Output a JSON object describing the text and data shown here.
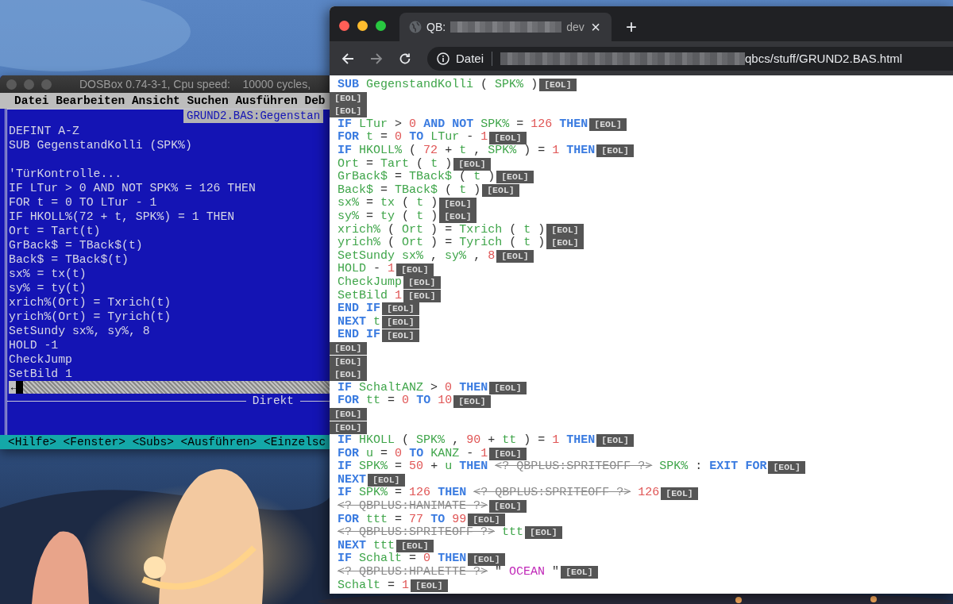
{
  "dosbox": {
    "title": "DOSBox 0.74-3-1, Cpu speed:    10000 cycles,",
    "menu": [
      "Datei",
      "Bearbeiten",
      "Ansicht",
      "Suchen",
      "Ausführen",
      "Deb"
    ],
    "file_tab": "GRUND2.BAS:Gegenstan",
    "code_lines": [
      {
        "kind": "code",
        "text": "DEFINT A-Z"
      },
      {
        "kind": "code",
        "text": "SUB GegenstandKolli (SPK%)"
      },
      {
        "kind": "blank"
      },
      {
        "kind": "code",
        "text": "'TürKontrolle..."
      },
      {
        "kind": "code",
        "text": "IF LTur > 0 AND NOT SPK% = 126 THEN"
      },
      {
        "kind": "code",
        "text": "FOR t = 0 TO LTur - 1"
      },
      {
        "kind": "code",
        "text": "IF HKOLL%(72 + t, SPK%) = 1 THEN"
      },
      {
        "kind": "code",
        "text": "Ort = Tart(t)"
      },
      {
        "kind": "code",
        "text": "GrBack$ = TBack$(t)"
      },
      {
        "kind": "code",
        "text": "Back$ = TBack$(t)"
      },
      {
        "kind": "code",
        "text": "sx% = tx(t)"
      },
      {
        "kind": "code",
        "text": "sy% = ty(t)"
      },
      {
        "kind": "code",
        "text": "xrich%(Ort) = Txrich(t)"
      },
      {
        "kind": "code",
        "text": "yrich%(Ort) = Tyrich(t)"
      },
      {
        "kind": "code",
        "text": "SetSundy sx%, sy%, 8"
      },
      {
        "kind": "code",
        "text": "HOLD -1"
      },
      {
        "kind": "code",
        "text": "CheckJump"
      },
      {
        "kind": "code",
        "text": "SetBild 1"
      }
    ],
    "scroll_arrow": "←",
    "immediate_title": "Direkt",
    "shortcuts": [
      "<Hilfe>",
      "<Fenster>",
      "<Subs>",
      "<Ausführen>",
      "<Einzelsc"
    ]
  },
  "browser": {
    "tab": {
      "title_start": "QB:",
      "title_end": "dev",
      "close": "×"
    },
    "new_tab": "+",
    "back": {
      "disabled": false
    },
    "forward": {
      "disabled": true
    },
    "address": {
      "scheme": "Datei",
      "url_end": "qbcs/stuff/GRUND2.BAS.html"
    },
    "lines": [
      {
        "eol": "[EOL]",
        "tokens": [
          {
            "kind": "kw",
            "text": "SUB"
          },
          {
            "kind": "id",
            "text": "GegenstandKolli"
          },
          {
            "kind": "op",
            "text": "("
          },
          {
            "kind": "id",
            "text": "SPK%"
          },
          {
            "kind": "op",
            "text": ")"
          }
        ]
      },
      {
        "eol": "[EOL]"
      },
      {
        "eol": "[EOL]"
      },
      {
        "eol": "[EOL]",
        "tokens": [
          {
            "kind": "kw",
            "text": "IF"
          },
          {
            "kind": "id",
            "text": "LTur"
          },
          {
            "kind": "op",
            "text": ">"
          },
          {
            "kind": "num",
            "text": "0"
          },
          {
            "kind": "kw",
            "text": "AND"
          },
          {
            "kind": "kw",
            "text": "NOT"
          },
          {
            "kind": "id",
            "text": "SPK%"
          },
          {
            "kind": "op",
            "text": "="
          },
          {
            "kind": "num",
            "text": "126"
          },
          {
            "kind": "kw",
            "text": "THEN"
          }
        ]
      },
      {
        "eol": "[EOL]",
        "tokens": [
          {
            "kind": "kw",
            "text": "FOR"
          },
          {
            "kind": "id",
            "text": "t"
          },
          {
            "kind": "op",
            "text": "="
          },
          {
            "kind": "num",
            "text": "0"
          },
          {
            "kind": "kw",
            "text": "TO"
          },
          {
            "kind": "id",
            "text": "LTur"
          },
          {
            "kind": "op",
            "text": "-"
          },
          {
            "kind": "num",
            "text": "1"
          }
        ]
      },
      {
        "eol": "[EOL]",
        "tokens": [
          {
            "kind": "kw",
            "text": "IF"
          },
          {
            "kind": "id",
            "text": "HKOLL%"
          },
          {
            "kind": "op",
            "text": "("
          },
          {
            "kind": "num",
            "text": "72"
          },
          {
            "kind": "op",
            "text": "+"
          },
          {
            "kind": "id",
            "text": "t"
          },
          {
            "kind": "op",
            "text": ","
          },
          {
            "kind": "id",
            "text": "SPK%"
          },
          {
            "kind": "op",
            "text": ")"
          },
          {
            "kind": "op",
            "text": "="
          },
          {
            "kind": "num",
            "text": "1"
          },
          {
            "kind": "kw",
            "text": "THEN"
          }
        ]
      },
      {
        "eol": "[EOL]",
        "tokens": [
          {
            "kind": "id",
            "text": "Ort"
          },
          {
            "kind": "op",
            "text": "="
          },
          {
            "kind": "id",
            "text": "Tart"
          },
          {
            "kind": "op",
            "text": "("
          },
          {
            "kind": "id",
            "text": "t"
          },
          {
            "kind": "op",
            "text": ")"
          }
        ]
      },
      {
        "eol": "[EOL]",
        "tokens": [
          {
            "kind": "id",
            "text": "GrBack$"
          },
          {
            "kind": "op",
            "text": "="
          },
          {
            "kind": "id",
            "text": "TBack$"
          },
          {
            "kind": "op",
            "text": "("
          },
          {
            "kind": "id",
            "text": "t"
          },
          {
            "kind": "op",
            "text": ")"
          }
        ]
      },
      {
        "eol": "[EOL]",
        "tokens": [
          {
            "kind": "id",
            "text": "Back$"
          },
          {
            "kind": "op",
            "text": "="
          },
          {
            "kind": "id",
            "text": "TBack$"
          },
          {
            "kind": "op",
            "text": "("
          },
          {
            "kind": "id",
            "text": "t"
          },
          {
            "kind": "op",
            "text": ")"
          }
        ]
      },
      {
        "eol": "[EOL]",
        "tokens": [
          {
            "kind": "id",
            "text": "sx%"
          },
          {
            "kind": "op",
            "text": "="
          },
          {
            "kind": "id",
            "text": "tx"
          },
          {
            "kind": "op",
            "text": "("
          },
          {
            "kind": "id",
            "text": "t"
          },
          {
            "kind": "op",
            "text": ")"
          }
        ]
      },
      {
        "eol": "[EOL]",
        "tokens": [
          {
            "kind": "id",
            "text": "sy%"
          },
          {
            "kind": "op",
            "text": "="
          },
          {
            "kind": "id",
            "text": "ty"
          },
          {
            "kind": "op",
            "text": "("
          },
          {
            "kind": "id",
            "text": "t"
          },
          {
            "kind": "op",
            "text": ")"
          }
        ]
      },
      {
        "eol": "[EOL]",
        "tokens": [
          {
            "kind": "id",
            "text": "xrich%"
          },
          {
            "kind": "op",
            "text": "("
          },
          {
            "kind": "id",
            "text": "Ort"
          },
          {
            "kind": "op",
            "text": ")"
          },
          {
            "kind": "op",
            "text": "="
          },
          {
            "kind": "id",
            "text": "Txrich"
          },
          {
            "kind": "op",
            "text": "("
          },
          {
            "kind": "id",
            "text": "t"
          },
          {
            "kind": "op",
            "text": ")"
          }
        ]
      },
      {
        "eol": "[EOL]",
        "tokens": [
          {
            "kind": "id",
            "text": "yrich%"
          },
          {
            "kind": "op",
            "text": "("
          },
          {
            "kind": "id",
            "text": "Ort"
          },
          {
            "kind": "op",
            "text": ")"
          },
          {
            "kind": "op",
            "text": "="
          },
          {
            "kind": "id",
            "text": "Tyrich"
          },
          {
            "kind": "op",
            "text": "("
          },
          {
            "kind": "id",
            "text": "t"
          },
          {
            "kind": "op",
            "text": ")"
          }
        ]
      },
      {
        "eol": "[EOL]",
        "tokens": [
          {
            "kind": "id",
            "text": "SetSundy"
          },
          {
            "kind": "id",
            "text": "sx%"
          },
          {
            "kind": "op",
            "text": ","
          },
          {
            "kind": "id",
            "text": "sy%"
          },
          {
            "kind": "op",
            "text": ","
          },
          {
            "kind": "num",
            "text": "8"
          }
        ]
      },
      {
        "eol": "[EOL]",
        "tokens": [
          {
            "kind": "id",
            "text": "HOLD"
          },
          {
            "kind": "op",
            "text": "-"
          },
          {
            "kind": "num",
            "text": "1"
          }
        ]
      },
      {
        "eol": "[EOL]",
        "tokens": [
          {
            "kind": "id",
            "text": "CheckJump"
          }
        ]
      },
      {
        "eol": "[EOL]",
        "tokens": [
          {
            "kind": "id",
            "text": "SetBild"
          },
          {
            "kind": "num",
            "text": "1"
          }
        ]
      },
      {
        "eol": "[EOL]",
        "tokens": [
          {
            "kind": "kw",
            "text": "END"
          },
          {
            "kind": "kw",
            "text": "IF"
          }
        ]
      },
      {
        "eol": "[EOL]",
        "tokens": [
          {
            "kind": "kw",
            "text": "NEXT"
          },
          {
            "kind": "id",
            "text": "t"
          }
        ]
      },
      {
        "eol": "[EOL]",
        "tokens": [
          {
            "kind": "kw",
            "text": "END"
          },
          {
            "kind": "kw",
            "text": "IF"
          }
        ]
      },
      {
        "eol": "[EOL]"
      },
      {
        "eol": "[EOL]"
      },
      {
        "eol": "[EOL]"
      },
      {
        "eol": "[EOL]",
        "tokens": [
          {
            "kind": "kw",
            "text": "IF"
          },
          {
            "kind": "id",
            "text": "SchaltANZ"
          },
          {
            "kind": "op",
            "text": ">"
          },
          {
            "kind": "num",
            "text": "0"
          },
          {
            "kind": "kw",
            "text": "THEN"
          }
        ]
      },
      {
        "eol": "[EOL]",
        "tokens": [
          {
            "kind": "kw",
            "text": "FOR"
          },
          {
            "kind": "id",
            "text": "tt"
          },
          {
            "kind": "op",
            "text": "="
          },
          {
            "kind": "num",
            "text": "0"
          },
          {
            "kind": "kw",
            "text": "TO"
          },
          {
            "kind": "num",
            "text": "10"
          }
        ]
      },
      {
        "eol": "[EOL]"
      },
      {
        "eol": "[EOL]"
      },
      {
        "eol": "[EOL]",
        "tokens": [
          {
            "kind": "kw",
            "text": "IF"
          },
          {
            "kind": "id",
            "text": "HKOLL"
          },
          {
            "kind": "op",
            "text": "("
          },
          {
            "kind": "id",
            "text": "SPK%"
          },
          {
            "kind": "op",
            "text": ","
          },
          {
            "kind": "num",
            "text": "90"
          },
          {
            "kind": "op",
            "text": "+"
          },
          {
            "kind": "id",
            "text": "tt"
          },
          {
            "kind": "op",
            "text": ")"
          },
          {
            "kind": "op",
            "text": "="
          },
          {
            "kind": "num",
            "text": "1"
          },
          {
            "kind": "kw",
            "text": "THEN"
          }
        ]
      },
      {
        "eol": "[EOL]",
        "tokens": [
          {
            "kind": "kw",
            "text": "FOR"
          },
          {
            "kind": "id",
            "text": "u"
          },
          {
            "kind": "op",
            "text": "="
          },
          {
            "kind": "num",
            "text": "0"
          },
          {
            "kind": "kw",
            "text": "TO"
          },
          {
            "kind": "id",
            "text": "KANZ"
          },
          {
            "kind": "op",
            "text": "-"
          },
          {
            "kind": "num",
            "text": "1"
          }
        ]
      },
      {
        "eol": "[EOL]",
        "tokens": [
          {
            "kind": "kw",
            "text": "IF"
          },
          {
            "kind": "id",
            "text": "SPK%"
          },
          {
            "kind": "op",
            "text": "="
          },
          {
            "kind": "num",
            "text": "50"
          },
          {
            "kind": "op",
            "text": "+"
          },
          {
            "kind": "id",
            "text": "u"
          },
          {
            "kind": "kw",
            "text": "THEN"
          },
          {
            "kind": "pp",
            "text": "<? QBPLUS:SPRITEOFF ?>"
          },
          {
            "kind": "id",
            "text": "SPK%"
          },
          {
            "kind": "op",
            "text": ":"
          },
          {
            "kind": "kw",
            "text": "EXIT"
          },
          {
            "kind": "kw",
            "text": "FOR"
          }
        ]
      },
      {
        "eol": "[EOL]",
        "tokens": [
          {
            "kind": "kw",
            "text": "NEXT"
          }
        ]
      },
      {
        "eol": "[EOL]",
        "tokens": [
          {
            "kind": "kw",
            "text": "IF"
          },
          {
            "kind": "id",
            "text": "SPK%"
          },
          {
            "kind": "op",
            "text": "="
          },
          {
            "kind": "num",
            "text": "126"
          },
          {
            "kind": "kw",
            "text": "THEN"
          },
          {
            "kind": "pp",
            "text": "<? QBPLUS:SPRITEOFF ?>"
          },
          {
            "kind": "num",
            "text": "126"
          }
        ]
      },
      {
        "eol": "[EOL]",
        "tokens": [
          {
            "kind": "pp",
            "text": "<? QBPLUS:HANIMATE ?>"
          }
        ]
      },
      {
        "eol": "[EOL]",
        "tokens": [
          {
            "kind": "kw",
            "text": "FOR"
          },
          {
            "kind": "id",
            "text": "ttt"
          },
          {
            "kind": "op",
            "text": "="
          },
          {
            "kind": "num",
            "text": "77"
          },
          {
            "kind": "kw",
            "text": "TO"
          },
          {
            "kind": "num",
            "text": "99"
          }
        ]
      },
      {
        "eol": "[EOL]",
        "tokens": [
          {
            "kind": "pp",
            "text": "<? QBPLUS:SPRITEOFF ?>"
          },
          {
            "kind": "id",
            "text": "ttt"
          }
        ]
      },
      {
        "eol": "[EOL]",
        "tokens": [
          {
            "kind": "kw",
            "text": "NEXT"
          },
          {
            "kind": "id",
            "text": "ttt"
          }
        ]
      },
      {
        "eol": "[EOL]",
        "tokens": [
          {
            "kind": "kw",
            "text": "IF"
          },
          {
            "kind": "id",
            "text": "Schalt"
          },
          {
            "kind": "op",
            "text": "="
          },
          {
            "kind": "num",
            "text": "0"
          },
          {
            "kind": "kw",
            "text": "THEN"
          }
        ]
      },
      {
        "eol": "[EOL]",
        "tokens": [
          {
            "kind": "pp",
            "text": "<? QBPLUS:HPALETTE ?>"
          },
          {
            "kind": "op",
            "text": "\""
          },
          {
            "kind": "str",
            "text": "OCEAN"
          },
          {
            "kind": "op",
            "text": "\""
          }
        ]
      },
      {
        "eol": "[EOL]",
        "tokens": [
          {
            "kind": "id",
            "text": "Schalt"
          },
          {
            "kind": "op",
            "text": "="
          },
          {
            "kind": "num",
            "text": "1"
          }
        ]
      }
    ]
  }
}
